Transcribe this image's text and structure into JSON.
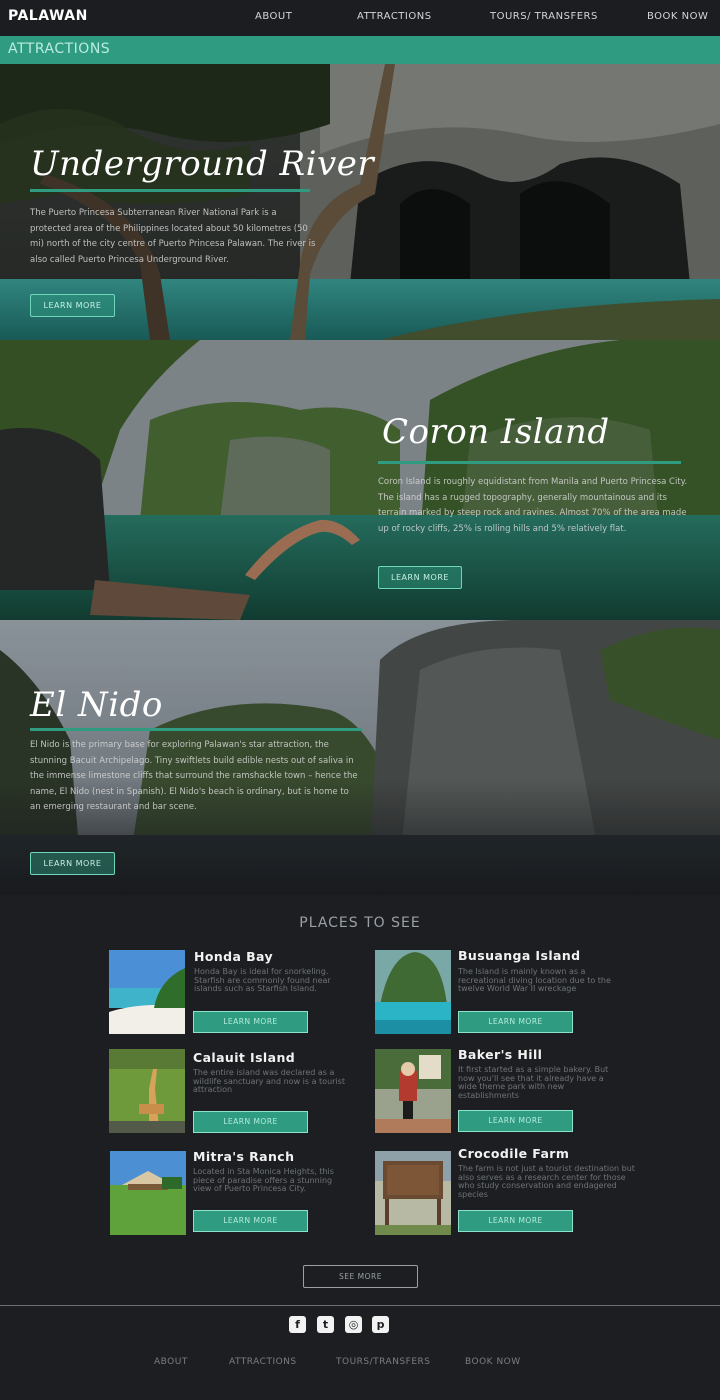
{
  "nav": {
    "logo": "PALAWAN",
    "items": [
      "ABOUT",
      "ATTRACTIONS",
      "TOURS/ TRANSFERS",
      "BOOK NOW"
    ]
  },
  "section": {
    "title": "ATTRACTIONS"
  },
  "heroes": [
    {
      "title": "Underground River",
      "text": "The Puerto Princesa Subterranean River National Park is a protected area of the Philippines located about 50 kilometres (50 mi) north of the city centre of Puerto Princesa Palawan. The river is also called Puerto Princesa Underground River.",
      "button": "LEARN MORE"
    },
    {
      "title": "Coron Island",
      "text": "Coron Island is roughly equidistant from Manila and Puerto Princesa City. The island has a rugged topography, generally mountainous and its terrain marked by steep rock and ravines. Almost 70% of the area made up of rocky cliffs, 25% is rolling hills and 5% relatively flat.",
      "button": "LEARN MORE"
    },
    {
      "title": "El Nido",
      "text": "El Nido is the primary base for exploring Palawan's star attraction, the stunning Bacuit Archipelago. Tiny swiftlets build edible nests out of saliva in the immense limestone cliffs that surround the ramshackle town – hence the name, El Nido (nest in Spanish). El Nido's beach is ordinary, but is home to an emerging restaurant and bar scene.",
      "button": "LEARN MORE"
    }
  ],
  "places": {
    "heading": "PLACES TO SEE",
    "items": [
      {
        "name": "Honda Bay",
        "desc": "Honda Bay is ideal for snorkeling. Starfish are commonly found near islands such as Starfish Island.",
        "button": "LEARN MORE"
      },
      {
        "name": "Busuanga Island",
        "desc": "The Island is mainly known as a recreational diving location due to the twelve World War II wreckage",
        "button": "LEARN MORE"
      },
      {
        "name": "Calauit Island",
        "desc": "The entire island was declared as a wildlife sanctuary and now is a tourist attraction",
        "button": "LEARN MORE"
      },
      {
        "name": "Baker's Hill",
        "desc": "It first started as a simple bakery. But now you'll see that it already have a wide theme park with new establishments",
        "button": "LEARN MORE"
      },
      {
        "name": "Mitra's Ranch",
        "desc": "Located in Sta Monica Heights, this piece of paradise offers a stunning view of Puerto Princesa City.",
        "button": "LEARN MORE"
      },
      {
        "name": "Crocodile Farm",
        "desc": "The farm is not just a tourist destination but also serves as a research center for those who study conservation and endagered species",
        "button": "LEARN MORE"
      }
    ],
    "see_more": "SEE MORE"
  },
  "footer": {
    "social": [
      {
        "icon": "facebook-icon",
        "glyph": "f"
      },
      {
        "icon": "twitter-icon",
        "glyph": "t"
      },
      {
        "icon": "instagram-icon",
        "glyph": "◎"
      },
      {
        "icon": "pinterest-icon",
        "glyph": "p"
      }
    ],
    "links": [
      "ABOUT",
      "ATTRACTIONS",
      "TOURS/TRANSFERS",
      "BOOK NOW"
    ]
  },
  "colors": {
    "accent": "#2f9b80",
    "background": "#1c1e21",
    "nav": "#1b1d20"
  }
}
